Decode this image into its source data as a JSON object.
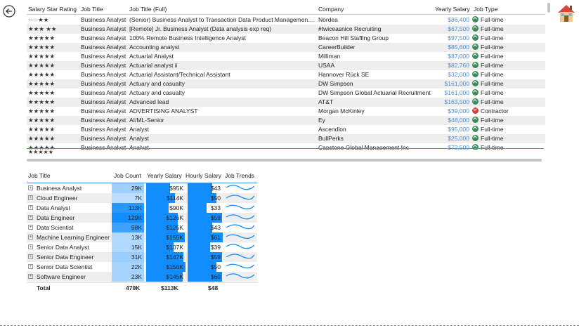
{
  "top_table": {
    "headers": {
      "salary_star_rating": "Salary Star Rating",
      "job_title": "Job Title",
      "job_title_full": "Job Title (Full)",
      "company": "Company",
      "yearly_salary": "Yearly Salary",
      "job_type": "Job Type"
    },
    "rows": [
      {
        "stars": "·····★★",
        "title": "Business Analyst",
        "full": "(Senior) Business Analyst to Transaction Data Product Management ...",
        "company": "Nordea",
        "salary": "$86,400",
        "type": "Full-time",
        "status": "ok"
      },
      {
        "stars": "★★★ ★★",
        "title": "Business Analyst",
        "full": "[Remote] Jr. Business Analyst (Data analysis exp req)",
        "company": "#twiceasnice Recruiting",
        "salary": "$67,500",
        "type": "Full-time",
        "status": "ok"
      },
      {
        "stars": "★★★★★",
        "title": "Business Analyst",
        "full": "100% Remote Business Intelligence Analyst",
        "company": "Beacon Hill Staffing Group",
        "salary": "$97,500",
        "type": "Full-time",
        "status": "ok"
      },
      {
        "stars": "★★★★★",
        "title": "Business Analyst",
        "full": "Accounting analyst",
        "company": "CareerBuilder",
        "salary": "$85,600",
        "type": "Full-time",
        "status": "ok"
      },
      {
        "stars": "★★★★★",
        "title": "Business Analyst",
        "full": "Actuarial Analyst",
        "company": "Milliman",
        "salary": "$87,000",
        "type": "Full-time",
        "status": "ok"
      },
      {
        "stars": "★★★★★",
        "title": "Business Analyst",
        "full": "Actuarial analyst ii",
        "company": "USAA",
        "salary": "$82,760",
        "type": "Full-time",
        "status": "ok"
      },
      {
        "stars": "★★★★★",
        "title": "Business Analyst",
        "full": "Actuarial Assistant/Technical Assistant",
        "company": "Hannover Rück SE",
        "salary": "$32,000",
        "type": "Full-time",
        "status": "ok"
      },
      {
        "stars": "★★★★★",
        "title": "Business Analyst",
        "full": "Actuary and casualty",
        "company": "DW Simpson",
        "salary": "$161,000",
        "type": "Full-time",
        "status": "ok"
      },
      {
        "stars": "★★★★★",
        "title": "Business Analyst",
        "full": "Actuary and casualty",
        "company": "DW Simpson Global Actuarial Recruitment",
        "salary": "$161,000",
        "type": "Full-time",
        "status": "ok"
      },
      {
        "stars": "★★★★★",
        "title": "Business Analyst",
        "full": "Advanced lead",
        "company": "AT&T",
        "salary": "$163,500",
        "type": "Full-time",
        "status": "ok"
      },
      {
        "stars": "★★★★★",
        "title": "Business Analyst",
        "full": "ADVERTISING ANALYST",
        "company": "Morgan McKinley",
        "salary": "$39,000",
        "type": "Contractor",
        "status": "bad"
      },
      {
        "stars": "★★★★★",
        "title": "Business Analyst",
        "full": "AI/ML-Senior",
        "company": "Ey",
        "salary": "$48,000",
        "type": "Full-time",
        "status": "ok"
      },
      {
        "stars": "★★★★★",
        "title": "Business Analyst",
        "full": "Analyst",
        "company": "Ascendion",
        "salary": "$95,000",
        "type": "Full-time",
        "status": "ok"
      },
      {
        "stars": "★★★★★",
        "title": "Business Analyst",
        "full": "Analyst",
        "company": "BullPerks",
        "salary": "$25,000",
        "type": "Full-time",
        "status": "ok"
      },
      {
        "stars": "★★★★★",
        "title": "Business Analyst",
        "full": "Analyst",
        "company": "Capstone Global Management Inc",
        "salary": "$72,500",
        "type": "Full-time",
        "status": "ok"
      }
    ],
    "footer_stars": "★★★★★"
  },
  "matrix": {
    "headers": {
      "job_title": "Job Title",
      "job_count": "Job Count",
      "yearly_salary": "Yearly Salary",
      "hourly_salary": "Hourly Salary",
      "job_trends": "Job Trends"
    },
    "rows": [
      {
        "title": "Business Analyst",
        "count": "29K",
        "count_v": 29,
        "yearly": "$95K",
        "yearly_v": 95,
        "hourly": "$43",
        "hourly_v": 43
      },
      {
        "title": "Cloud Engineer",
        "count": "7K",
        "count_v": 7,
        "yearly": "$114K",
        "yearly_v": 114,
        "hourly": "$50",
        "hourly_v": 50
      },
      {
        "title": "Data Analyst",
        "count": "113K",
        "count_v": 113,
        "yearly": "$90K",
        "yearly_v": 90,
        "hourly": "$33",
        "hourly_v": 33
      },
      {
        "title": "Data Engineer",
        "count": "129K",
        "count_v": 129,
        "yearly": "$126K",
        "yearly_v": 126,
        "hourly": "$59",
        "hourly_v": 59
      },
      {
        "title": "Data Scientist",
        "count": "98K",
        "count_v": 98,
        "yearly": "$125K",
        "yearly_v": 125,
        "hourly": "$43",
        "hourly_v": 43
      },
      {
        "title": "Machine Learning Engineer",
        "count": "13K",
        "count_v": 13,
        "yearly": "$155K",
        "yearly_v": 155,
        "hourly": "$61",
        "hourly_v": 61
      },
      {
        "title": "Senior Data Analyst",
        "count": "15K",
        "count_v": 15,
        "yearly": "$107K",
        "yearly_v": 107,
        "hourly": "$39",
        "hourly_v": 39
      },
      {
        "title": "Senior Data Engineer",
        "count": "31K",
        "count_v": 31,
        "yearly": "$147K",
        "yearly_v": 147,
        "hourly": "$59",
        "hourly_v": 59
      },
      {
        "title": "Senior Data Scientist",
        "count": "22K",
        "count_v": 22,
        "yearly": "$156K",
        "yearly_v": 156,
        "hourly": "$50",
        "hourly_v": 50
      },
      {
        "title": "Software Engineer",
        "count": "23K",
        "count_v": 23,
        "yearly": "$145K",
        "yearly_v": 145,
        "hourly": "$60",
        "hourly_v": 60
      }
    ],
    "total": {
      "label": "Total",
      "count": "479K",
      "yearly": "$113K",
      "hourly": "$48"
    }
  },
  "icons": {
    "back": "back-arrow-icon",
    "home": "home-icon"
  },
  "colors": {
    "accent": "#4a90d9",
    "ok": "#3a8a5a",
    "bad": "#d93a3a",
    "bar_dark": "#118dff",
    "bar_light": "#c6e2ff"
  }
}
